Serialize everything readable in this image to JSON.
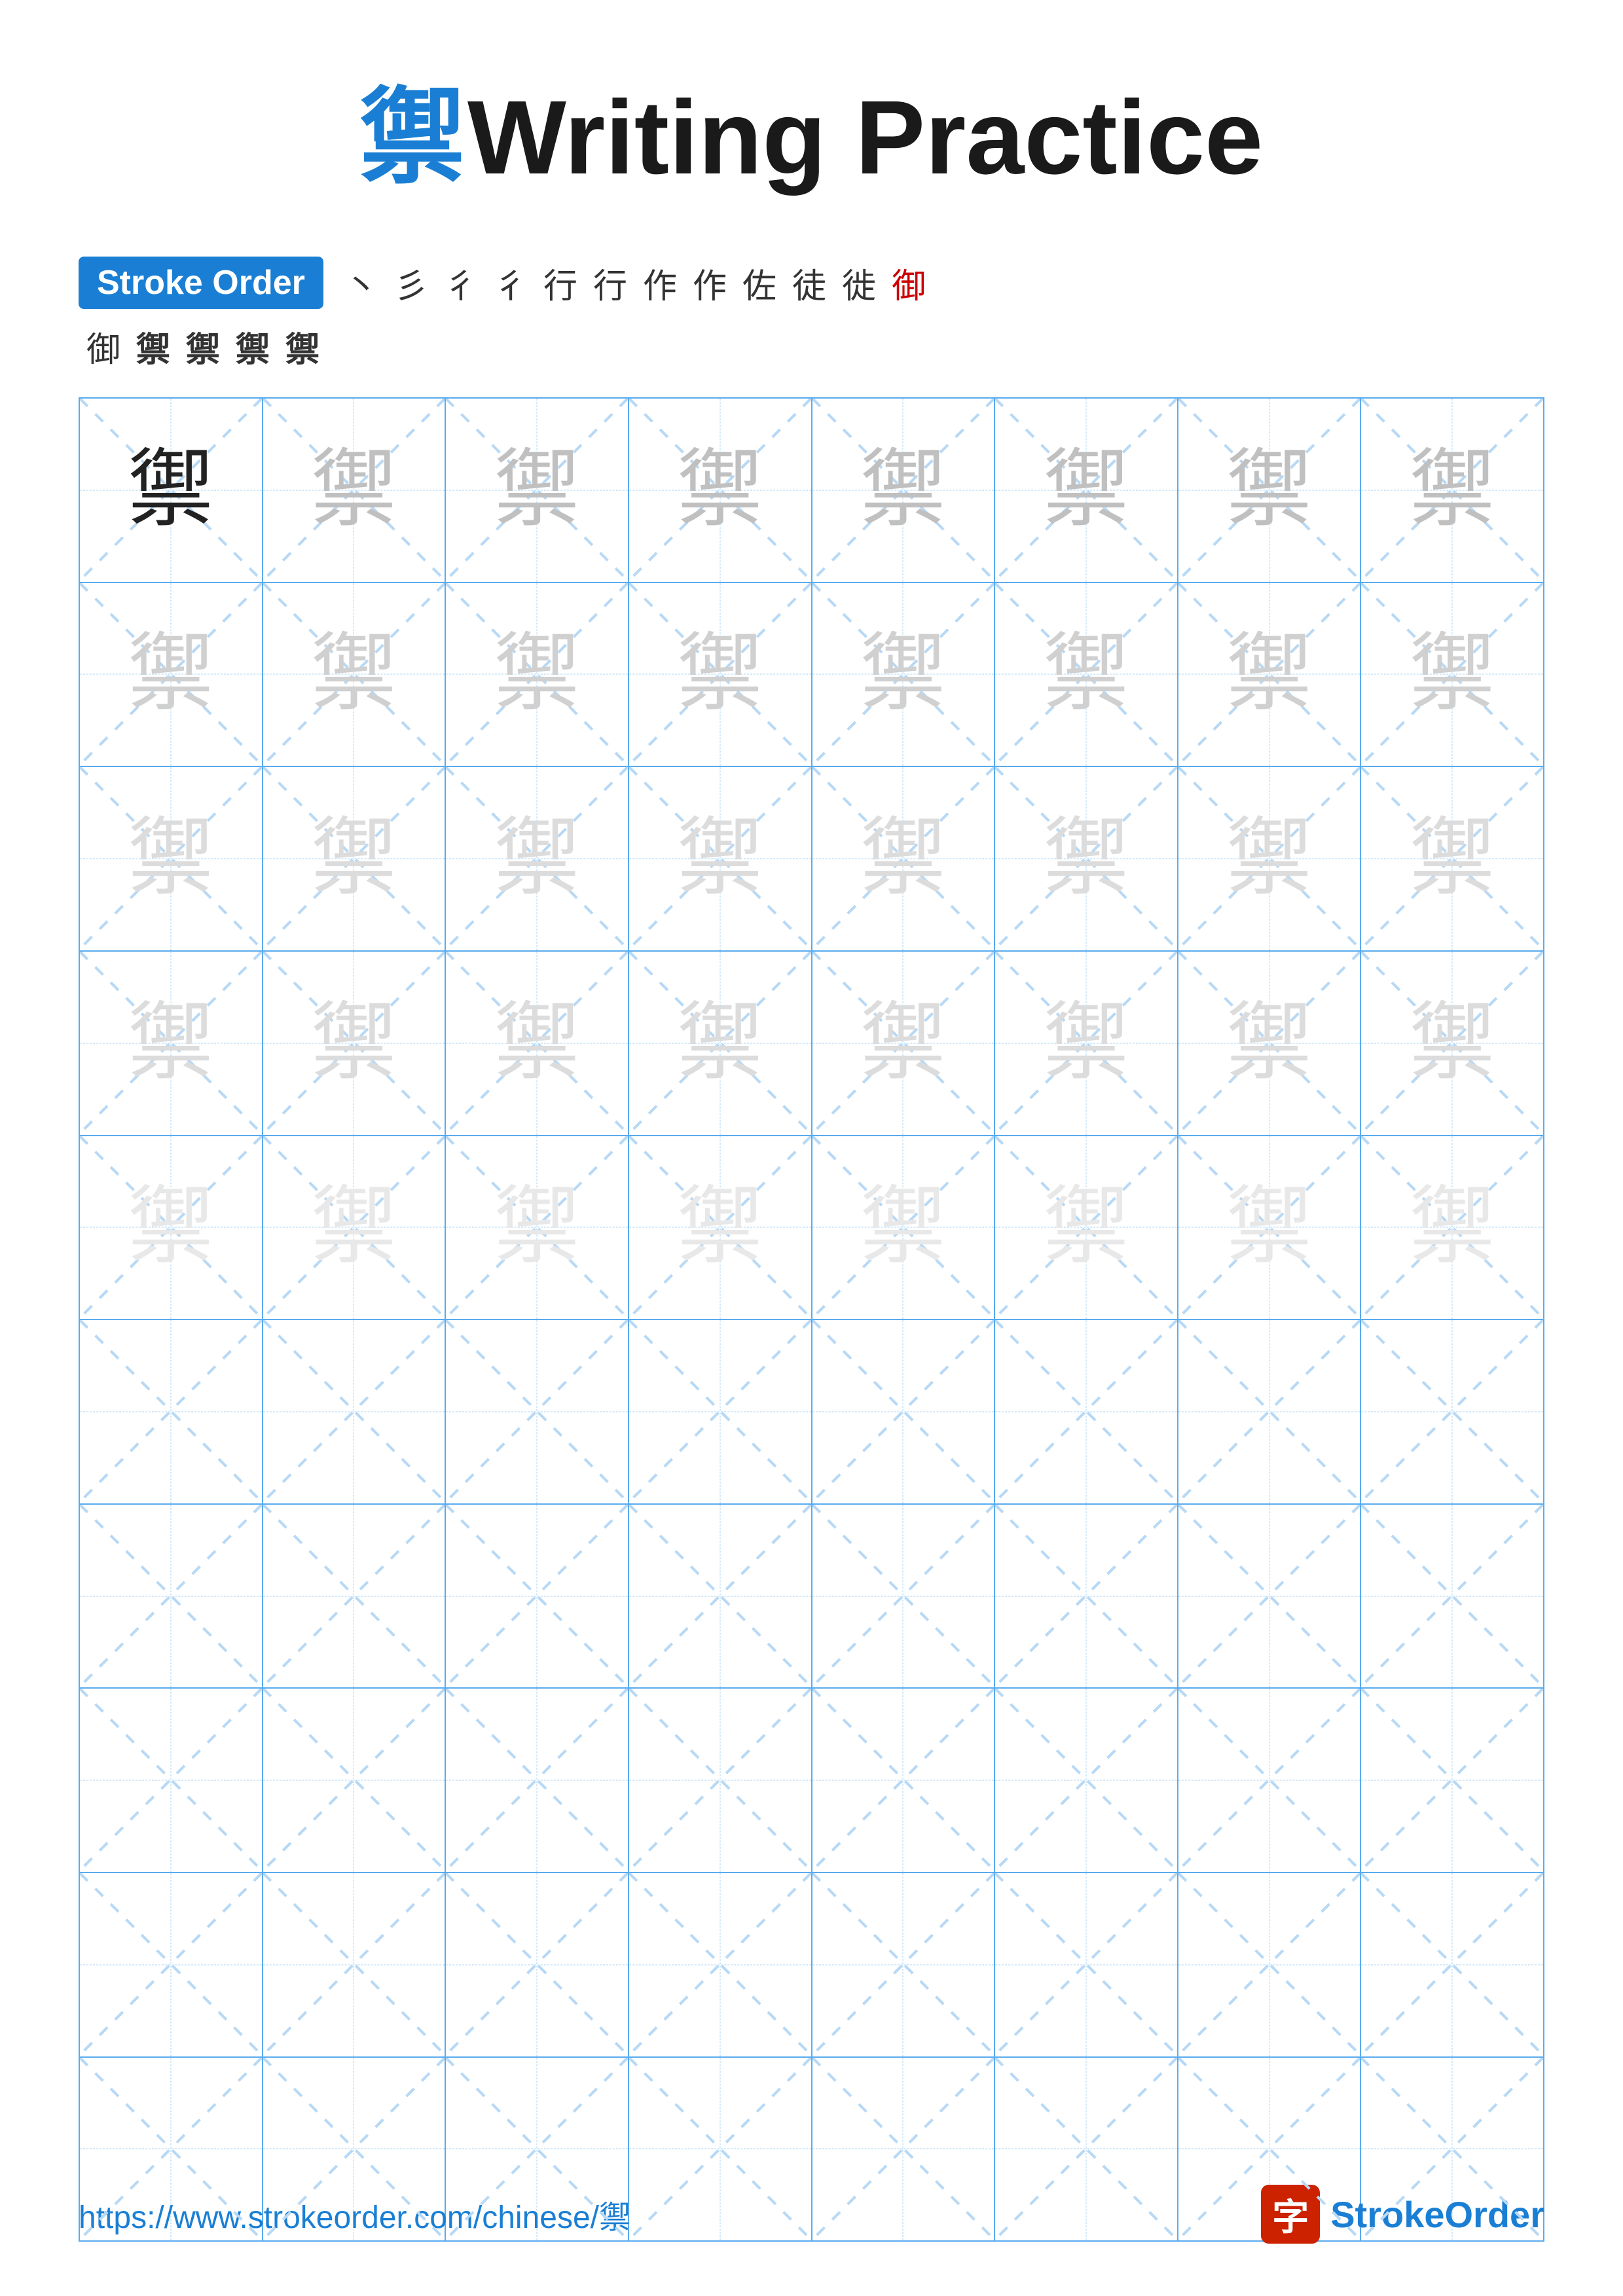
{
  "title": {
    "char": "禦",
    "writing": "Writing Practice",
    "combined": "禦 Writing Practice"
  },
  "strokeOrder": {
    "badge": "Stroke Order",
    "steps": [
      "丶",
      "彳",
      "彳",
      "行",
      "行",
      "作",
      "作",
      "佐",
      "徒",
      "徙",
      "御",
      "御",
      "禦",
      "禦",
      "禦",
      "禦",
      "禦"
    ]
  },
  "grid": {
    "rows": 10,
    "cols": 8,
    "char": "禦",
    "filledRows": 5,
    "emptyRows": 5
  },
  "footer": {
    "url": "https://www.strokeorder.com/chinese/禦",
    "logoText": "StrokeOrder",
    "logoChar": "字"
  },
  "colors": {
    "blue": "#1a7fd4",
    "red": "#cc0000",
    "gridBlue": "#5aabee",
    "dashedBlue": "#a8d4f5"
  }
}
